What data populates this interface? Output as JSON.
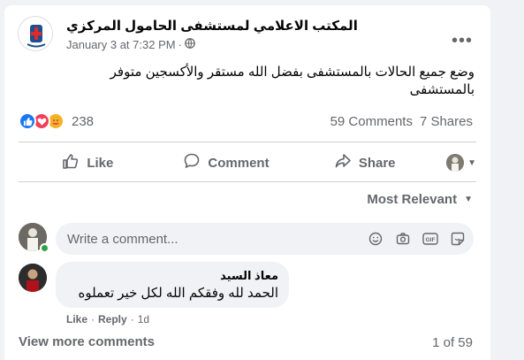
{
  "post": {
    "page_name": "المكتب الاعلامي لمستشفى الحامول المركزي",
    "date": "January 3 at 7:32 PM",
    "separator": "·",
    "text": "وضع جميع الحالات بالمستشفى بفضل الله مستقر والأكسجين متوفر بالمستشفى"
  },
  "stats": {
    "reaction_count": "238",
    "comments": "59 Comments",
    "shares": "7 Shares"
  },
  "actions": {
    "like": "Like",
    "comment": "Comment",
    "share": "Share"
  },
  "sort": {
    "label": "Most Relevant"
  },
  "composer": {
    "placeholder": "Write a comment..."
  },
  "comment": {
    "author": "معاذ السيد",
    "text": "الحمد لله وفقكم الله لكل خير تعملوه",
    "like": "Like",
    "dot": "·",
    "reply": "Reply",
    "time": "1d"
  },
  "footer": {
    "view_more": "View more comments",
    "pager": "1 of 59"
  },
  "colors": {
    "like_blue": "#1877f2",
    "love_red": "#f33e58",
    "care_yellow": "#f7b125",
    "online_green": "#31a24c",
    "muted_text": "#65676b"
  }
}
